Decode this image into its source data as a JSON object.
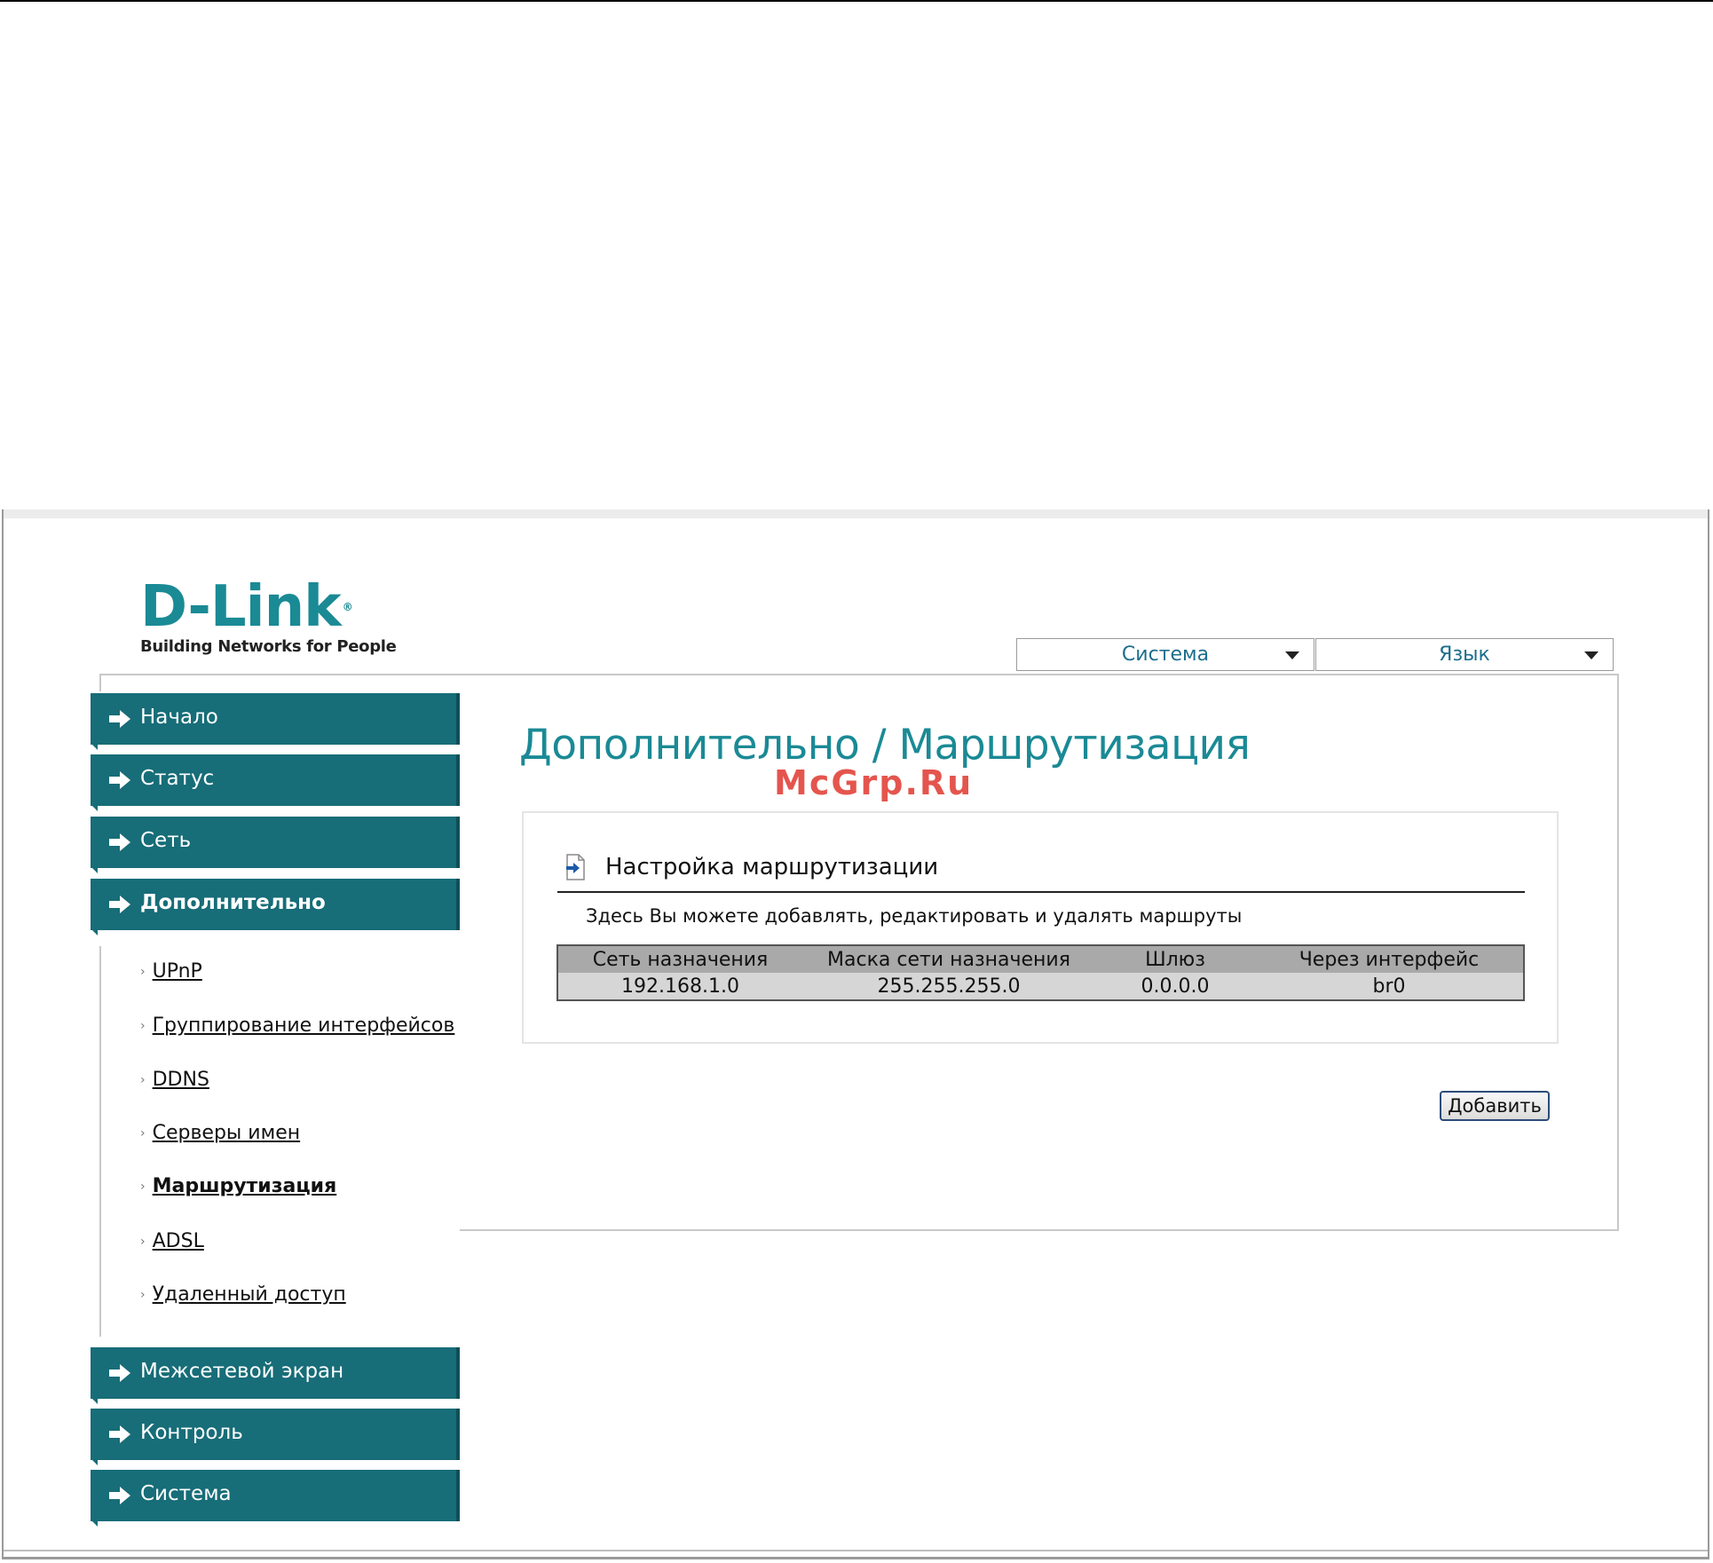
{
  "logo": {
    "name": "D-Link",
    "registered": "®",
    "tagline": "Building Networks for People"
  },
  "top_menu": {
    "system_label": "Система",
    "language_label": "Язык"
  },
  "sidebar": {
    "items": [
      {
        "label": "Начало"
      },
      {
        "label": "Статус"
      },
      {
        "label": "Сеть"
      },
      {
        "label": "Дополнительно"
      },
      {
        "label": "Межсетевой экран"
      },
      {
        "label": "Контроль"
      },
      {
        "label": "Система"
      }
    ],
    "submenu": [
      {
        "label": "UPnP"
      },
      {
        "label": "Группирование интерфейсов"
      },
      {
        "label": "DDNS"
      },
      {
        "label": "Серверы имен"
      },
      {
        "label": "Маршрутизация"
      },
      {
        "label": "ADSL"
      },
      {
        "label": "Удаленный доступ"
      }
    ]
  },
  "main": {
    "title": "Дополнительно /  Маршрутизация",
    "watermark": "McGrp.Ru",
    "section_title": "Настройка маршрутизации",
    "section_description": "Здесь Вы можете добавлять, редактировать и удалять маршруты",
    "table": {
      "headers": [
        "Сеть назначения",
        "Маска сети назначения",
        "Шлюз",
        "Через интерфейс"
      ],
      "rows": [
        [
          "192.168.1.0",
          "255.255.255.0",
          "0.0.0.0",
          "br0"
        ]
      ]
    },
    "add_button_label": "Добавить"
  },
  "colors": {
    "brand_teal": "#1a8a95",
    "nav_teal": "#176d78",
    "link_blue": "#1c6e8c",
    "watermark_red": "#e0382e"
  }
}
